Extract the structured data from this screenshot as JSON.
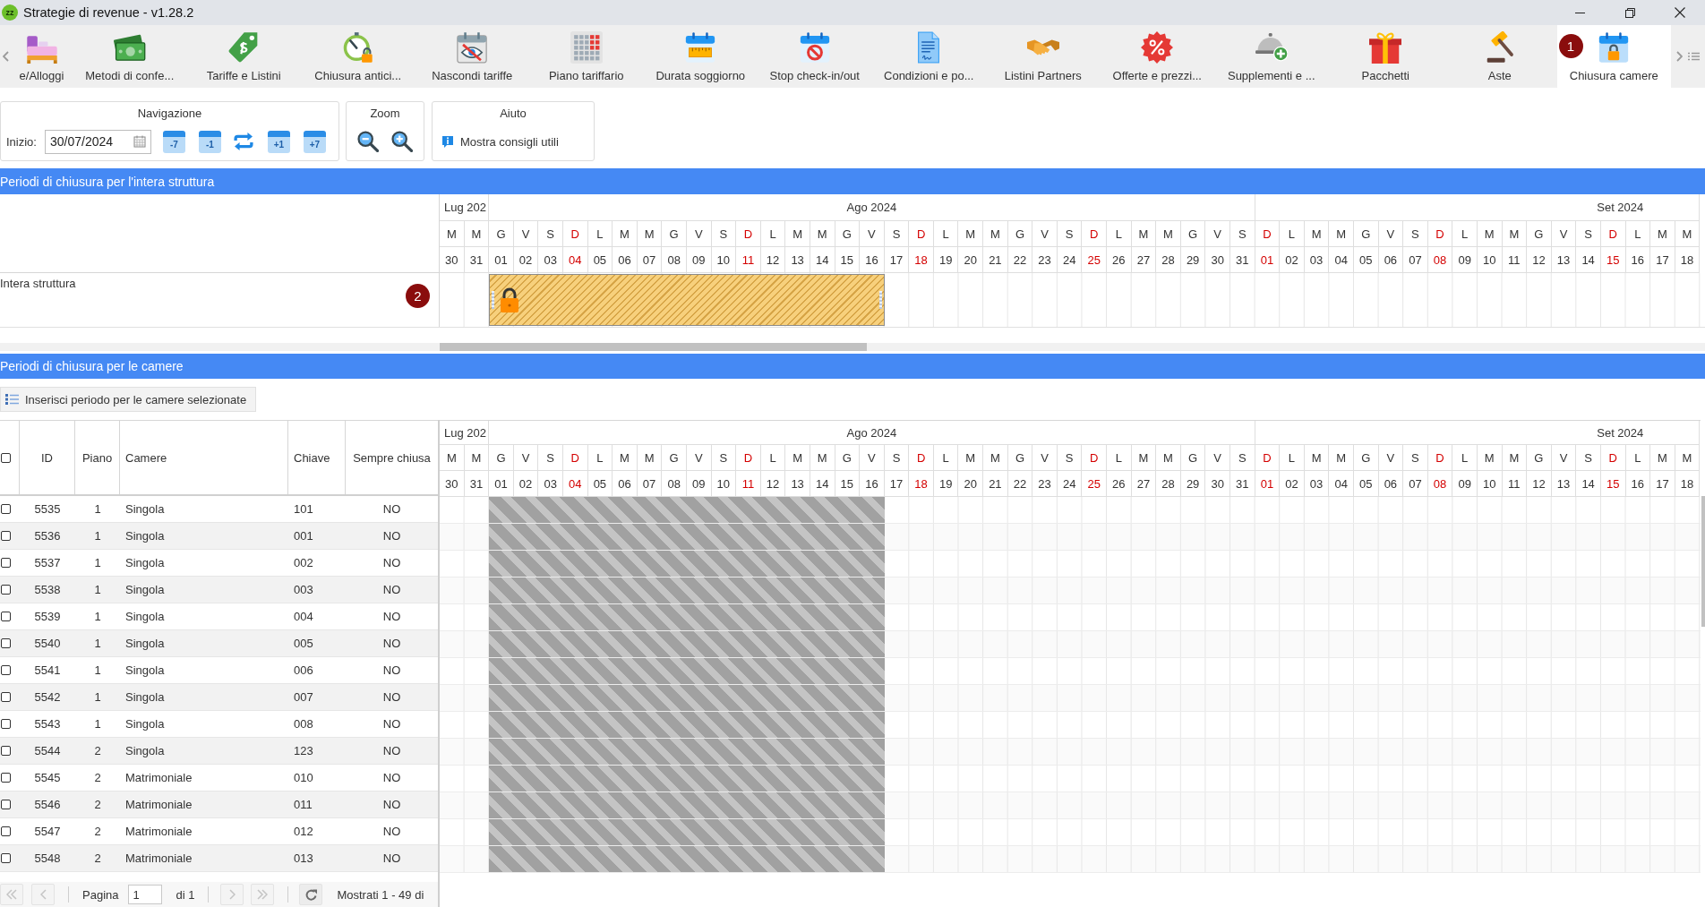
{
  "window": {
    "logo": "zz",
    "title": "Strategie di revenue - v1.28.2"
  },
  "toolbar": {
    "items": [
      {
        "label": "e/Alloggi",
        "selected": false
      },
      {
        "label": "Metodi di confe...",
        "selected": false
      },
      {
        "label": "Tariffe e Listini",
        "selected": false
      },
      {
        "label": "Chiusura antici...",
        "selected": false
      },
      {
        "label": "Nascondi tariffe",
        "selected": false
      },
      {
        "label": "Piano tariffario",
        "selected": false
      },
      {
        "label": "Durata soggiorno",
        "selected": false
      },
      {
        "label": "Stop check-in/out",
        "selected": false
      },
      {
        "label": "Condizioni e po...",
        "selected": false
      },
      {
        "label": "Listini Partners",
        "selected": false
      },
      {
        "label": "Offerte e prezzi...",
        "selected": false
      },
      {
        "label": "Supplementi e ...",
        "selected": false
      },
      {
        "label": "Pacchetti",
        "selected": false
      },
      {
        "label": "Aste",
        "selected": false
      },
      {
        "label": "Chiusura camere",
        "selected": true,
        "badge": "1"
      }
    ]
  },
  "navigation": {
    "title": "Navigazione",
    "start_label": "Inizio:",
    "start_date": "30/07/2024",
    "buttons": [
      {
        "kind": "step",
        "label": "-7"
      },
      {
        "kind": "step",
        "label": "-1"
      },
      {
        "kind": "swap"
      },
      {
        "kind": "step",
        "label": "+1"
      },
      {
        "kind": "step",
        "label": "+7"
      }
    ]
  },
  "zoom": {
    "title": "Zoom"
  },
  "help": {
    "title": "Aiuto",
    "link": "Mostra consigli utili"
  },
  "structure_section": {
    "title": "Periodi di chiusura per l'intera struttura",
    "calendar": {
      "months": [
        {
          "label": "Lug 202",
          "days": [
            {
              "weekday": "M",
              "day": "30",
              "sunday": false
            },
            {
              "weekday": "M",
              "day": "31",
              "sunday": false
            }
          ]
        },
        {
          "label": "Ago 2024",
          "days": [
            {
              "weekday": "G",
              "day": "01",
              "sunday": false
            },
            {
              "weekday": "V",
              "day": "02",
              "sunday": false
            },
            {
              "weekday": "S",
              "day": "03",
              "sunday": false
            },
            {
              "weekday": "D",
              "day": "04",
              "sunday": true
            },
            {
              "weekday": "L",
              "day": "05",
              "sunday": false
            },
            {
              "weekday": "M",
              "day": "06",
              "sunday": false
            },
            {
              "weekday": "M",
              "day": "07",
              "sunday": false
            },
            {
              "weekday": "G",
              "day": "08",
              "sunday": false
            },
            {
              "weekday": "V",
              "day": "09",
              "sunday": false
            },
            {
              "weekday": "S",
              "day": "10",
              "sunday": false
            },
            {
              "weekday": "D",
              "day": "11",
              "sunday": true
            },
            {
              "weekday": "L",
              "day": "12",
              "sunday": false
            },
            {
              "weekday": "M",
              "day": "13",
              "sunday": false
            },
            {
              "weekday": "M",
              "day": "14",
              "sunday": false
            },
            {
              "weekday": "G",
              "day": "15",
              "sunday": false
            },
            {
              "weekday": "V",
              "day": "16",
              "sunday": false
            },
            {
              "weekday": "S",
              "day": "17",
              "sunday": false
            },
            {
              "weekday": "D",
              "day": "18",
              "sunday": true
            },
            {
              "weekday": "L",
              "day": "19",
              "sunday": false
            },
            {
              "weekday": "M",
              "day": "20",
              "sunday": false
            },
            {
              "weekday": "M",
              "day": "21",
              "sunday": false
            },
            {
              "weekday": "G",
              "day": "22",
              "sunday": false
            },
            {
              "weekday": "V",
              "day": "23",
              "sunday": false
            },
            {
              "weekday": "S",
              "day": "24",
              "sunday": false
            },
            {
              "weekday": "D",
              "day": "25",
              "sunday": true
            },
            {
              "weekday": "L",
              "day": "26",
              "sunday": false
            },
            {
              "weekday": "M",
              "day": "27",
              "sunday": false
            },
            {
              "weekday": "M",
              "day": "28",
              "sunday": false
            },
            {
              "weekday": "G",
              "day": "29",
              "sunday": false
            },
            {
              "weekday": "V",
              "day": "30",
              "sunday": false
            },
            {
              "weekday": "S",
              "day": "31",
              "sunday": false
            }
          ]
        },
        {
          "label": "Set 2024",
          "days": [
            {
              "weekday": "D",
              "day": "01",
              "sunday": true
            },
            {
              "weekday": "L",
              "day": "02",
              "sunday": false
            },
            {
              "weekday": "M",
              "day": "03",
              "sunday": false
            },
            {
              "weekday": "M",
              "day": "04",
              "sunday": false
            },
            {
              "weekday": "G",
              "day": "05",
              "sunday": false
            },
            {
              "weekday": "V",
              "day": "06",
              "sunday": false
            },
            {
              "weekday": "S",
              "day": "07",
              "sunday": false
            },
            {
              "weekday": "D",
              "day": "08",
              "sunday": true
            },
            {
              "weekday": "L",
              "day": "09",
              "sunday": false
            },
            {
              "weekday": "M",
              "day": "10",
              "sunday": false
            },
            {
              "weekday": "M",
              "day": "11",
              "sunday": false
            },
            {
              "weekday": "G",
              "day": "12",
              "sunday": false
            },
            {
              "weekday": "V",
              "day": "13",
              "sunday": false
            },
            {
              "weekday": "S",
              "day": "14",
              "sunday": false
            },
            {
              "weekday": "D",
              "day": "15",
              "sunday": true
            },
            {
              "weekday": "L",
              "day": "16",
              "sunday": false
            },
            {
              "weekday": "M",
              "day": "17",
              "sunday": false
            },
            {
              "weekday": "M",
              "day": "18",
              "sunday": false
            }
          ]
        }
      ]
    },
    "row": {
      "label": "Intera struttura",
      "badge": "2",
      "closed": true,
      "locked": true
    }
  },
  "rooms_section": {
    "title": "Periodi di chiusura per le camere",
    "action": "Inserisci periodo per le camere selezionate",
    "table": {
      "select_all": {
        "checked": false
      },
      "columns": [
        "ID",
        "Piano",
        "Camere",
        "Chiave",
        "Sempre chiusa"
      ],
      "calendar": {
        "months": [
          {
            "label": "Lug 202",
            "days": [
              {
                "weekday": "M",
                "day": "30",
                "sunday": false
              },
              {
                "weekday": "M",
                "day": "31",
                "sunday": false
              }
            ]
          },
          {
            "label": "Ago 2024",
            "days": [
              {
                "weekday": "G",
                "day": "01",
                "sunday": false
              },
              {
                "weekday": "V",
                "day": "02",
                "sunday": false
              },
              {
                "weekday": "S",
                "day": "03",
                "sunday": false
              },
              {
                "weekday": "D",
                "day": "04",
                "sunday": true
              },
              {
                "weekday": "L",
                "day": "05",
                "sunday": false
              },
              {
                "weekday": "M",
                "day": "06",
                "sunday": false
              },
              {
                "weekday": "M",
                "day": "07",
                "sunday": false
              },
              {
                "weekday": "G",
                "day": "08",
                "sunday": false
              },
              {
                "weekday": "V",
                "day": "09",
                "sunday": false
              },
              {
                "weekday": "S",
                "day": "10",
                "sunday": false
              },
              {
                "weekday": "D",
                "day": "11",
                "sunday": true
              },
              {
                "weekday": "L",
                "day": "12",
                "sunday": false
              },
              {
                "weekday": "M",
                "day": "13",
                "sunday": false
              },
              {
                "weekday": "M",
                "day": "14",
                "sunday": false
              },
              {
                "weekday": "G",
                "day": "15",
                "sunday": false
              },
              {
                "weekday": "V",
                "day": "16",
                "sunday": false
              },
              {
                "weekday": "S",
                "day": "17",
                "sunday": false
              },
              {
                "weekday": "D",
                "day": "18",
                "sunday": true
              },
              {
                "weekday": "L",
                "day": "19",
                "sunday": false
              },
              {
                "weekday": "M",
                "day": "20",
                "sunday": false
              },
              {
                "weekday": "M",
                "day": "21",
                "sunday": false
              },
              {
                "weekday": "G",
                "day": "22",
                "sunday": false
              },
              {
                "weekday": "V",
                "day": "23",
                "sunday": false
              },
              {
                "weekday": "S",
                "day": "24",
                "sunday": false
              },
              {
                "weekday": "D",
                "day": "25",
                "sunday": true
              },
              {
                "weekday": "L",
                "day": "26",
                "sunday": false
              },
              {
                "weekday": "M",
                "day": "27",
                "sunday": false
              },
              {
                "weekday": "M",
                "day": "28",
                "sunday": false
              },
              {
                "weekday": "G",
                "day": "29",
                "sunday": false
              },
              {
                "weekday": "V",
                "day": "30",
                "sunday": false
              },
              {
                "weekday": "S",
                "day": "31",
                "sunday": false
              }
            ]
          },
          {
            "label": "Set 2024",
            "days": [
              {
                "weekday": "D",
                "day": "01",
                "sunday": true
              },
              {
                "weekday": "L",
                "day": "02",
                "sunday": false
              },
              {
                "weekday": "M",
                "day": "03",
                "sunday": false
              },
              {
                "weekday": "M",
                "day": "04",
                "sunday": false
              },
              {
                "weekday": "G",
                "day": "05",
                "sunday": false
              },
              {
                "weekday": "V",
                "day": "06",
                "sunday": false
              },
              {
                "weekday": "S",
                "day": "07",
                "sunday": false
              },
              {
                "weekday": "D",
                "day": "08",
                "sunday": true
              },
              {
                "weekday": "L",
                "day": "09",
                "sunday": false
              },
              {
                "weekday": "M",
                "day": "10",
                "sunday": false
              },
              {
                "weekday": "M",
                "day": "11",
                "sunday": false
              },
              {
                "weekday": "G",
                "day": "12",
                "sunday": false
              },
              {
                "weekday": "V",
                "day": "13",
                "sunday": false
              },
              {
                "weekday": "S",
                "day": "14",
                "sunday": false
              },
              {
                "weekday": "D",
                "day": "15",
                "sunday": true
              },
              {
                "weekday": "L",
                "day": "16",
                "sunday": false
              },
              {
                "weekday": "M",
                "day": "17",
                "sunday": false
              },
              {
                "weekday": "M",
                "day": "18",
                "sunday": false
              }
            ]
          }
        ]
      },
      "rows": [
        {
          "checked": false,
          "id": "5535",
          "floor": "1",
          "room": "Singola",
          "key": "101",
          "always_closed": "NO",
          "closed": true
        },
        {
          "checked": false,
          "id": "5536",
          "floor": "1",
          "room": "Singola",
          "key": "001",
          "always_closed": "NO",
          "closed": true
        },
        {
          "checked": false,
          "id": "5537",
          "floor": "1",
          "room": "Singola",
          "key": "002",
          "always_closed": "NO",
          "closed": true
        },
        {
          "checked": false,
          "id": "5538",
          "floor": "1",
          "room": "Singola",
          "key": "003",
          "always_closed": "NO",
          "closed": true
        },
        {
          "checked": false,
          "id": "5539",
          "floor": "1",
          "room": "Singola",
          "key": "004",
          "always_closed": "NO",
          "closed": true
        },
        {
          "checked": false,
          "id": "5540",
          "floor": "1",
          "room": "Singola",
          "key": "005",
          "always_closed": "NO",
          "closed": true
        },
        {
          "checked": false,
          "id": "5541",
          "floor": "1",
          "room": "Singola",
          "key": "006",
          "always_closed": "NO",
          "closed": true
        },
        {
          "checked": false,
          "id": "5542",
          "floor": "1",
          "room": "Singola",
          "key": "007",
          "always_closed": "NO",
          "closed": true
        },
        {
          "checked": false,
          "id": "5543",
          "floor": "1",
          "room": "Singola",
          "key": "008",
          "always_closed": "NO",
          "closed": true
        },
        {
          "checked": false,
          "id": "5544",
          "floor": "2",
          "room": "Singola",
          "key": "123",
          "always_closed": "NO",
          "closed": true
        },
        {
          "checked": false,
          "id": "5545",
          "floor": "2",
          "room": "Matrimoniale",
          "key": "010",
          "always_closed": "NO",
          "closed": true
        },
        {
          "checked": false,
          "id": "5546",
          "floor": "2",
          "room": "Matrimoniale",
          "key": "011",
          "always_closed": "NO",
          "closed": true
        },
        {
          "checked": false,
          "id": "5547",
          "floor": "2",
          "room": "Matrimoniale",
          "key": "012",
          "always_closed": "NO",
          "closed": true
        },
        {
          "checked": false,
          "id": "5548",
          "floor": "2",
          "room": "Matrimoniale",
          "key": "013",
          "always_closed": "NO",
          "closed": true
        }
      ]
    },
    "pager": {
      "first": {
        "disabled": true
      },
      "previous": {
        "disabled": true
      },
      "page_label": "Pagina",
      "page": "1",
      "page_total": "di 1",
      "next": {
        "disabled": true
      },
      "last": {
        "disabled": true
      },
      "summary": "Mostrati 1 - 49 di"
    }
  }
}
